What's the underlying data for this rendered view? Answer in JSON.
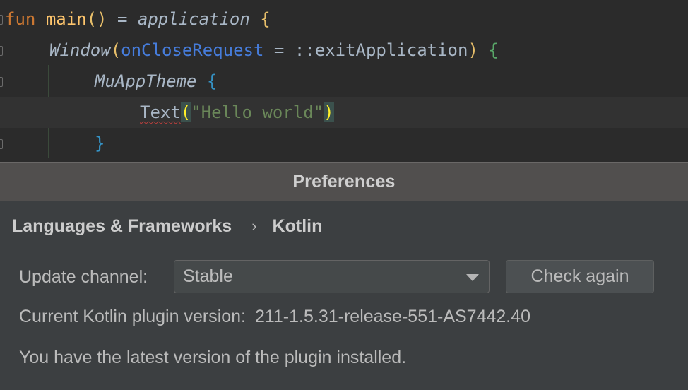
{
  "editor": {
    "line1": {
      "fun": "fun",
      "main": "main",
      "parens": "()",
      "eq": " = ",
      "application": "application",
      "brace": "{"
    },
    "line2": {
      "window": "Window",
      "open_paren": "(",
      "param": "onCloseRequest",
      "eq": " = ",
      "ref": "::exitApplication",
      "close_paren": ")",
      "brace": "{"
    },
    "line3": {
      "theme": "MuAppTheme",
      "brace": "{"
    },
    "line4": {
      "text": "Text",
      "open_paren": "(",
      "string": "\"Hello world\"",
      "close_paren": ")"
    },
    "line5": {
      "brace": "}"
    }
  },
  "dialog": {
    "title": "Preferences",
    "breadcrumb": {
      "parent": "Languages & Frameworks",
      "separator": "›",
      "current": "Kotlin"
    },
    "update_channel_label": "Update channel:",
    "update_channel_value": "Stable",
    "check_button": "Check again",
    "version_label": "Current Kotlin plugin version:",
    "version_value": "211-1.5.31-release-551-AS7442.40",
    "status_message": "You have the latest version of the plugin installed."
  },
  "colors": {
    "editor_bg": "#2b2b2b",
    "dialog_bg": "#3c3f41",
    "keyword": "#cc7832",
    "function": "#ffc66d",
    "parameter": "#467cda",
    "string": "#6a8759"
  }
}
